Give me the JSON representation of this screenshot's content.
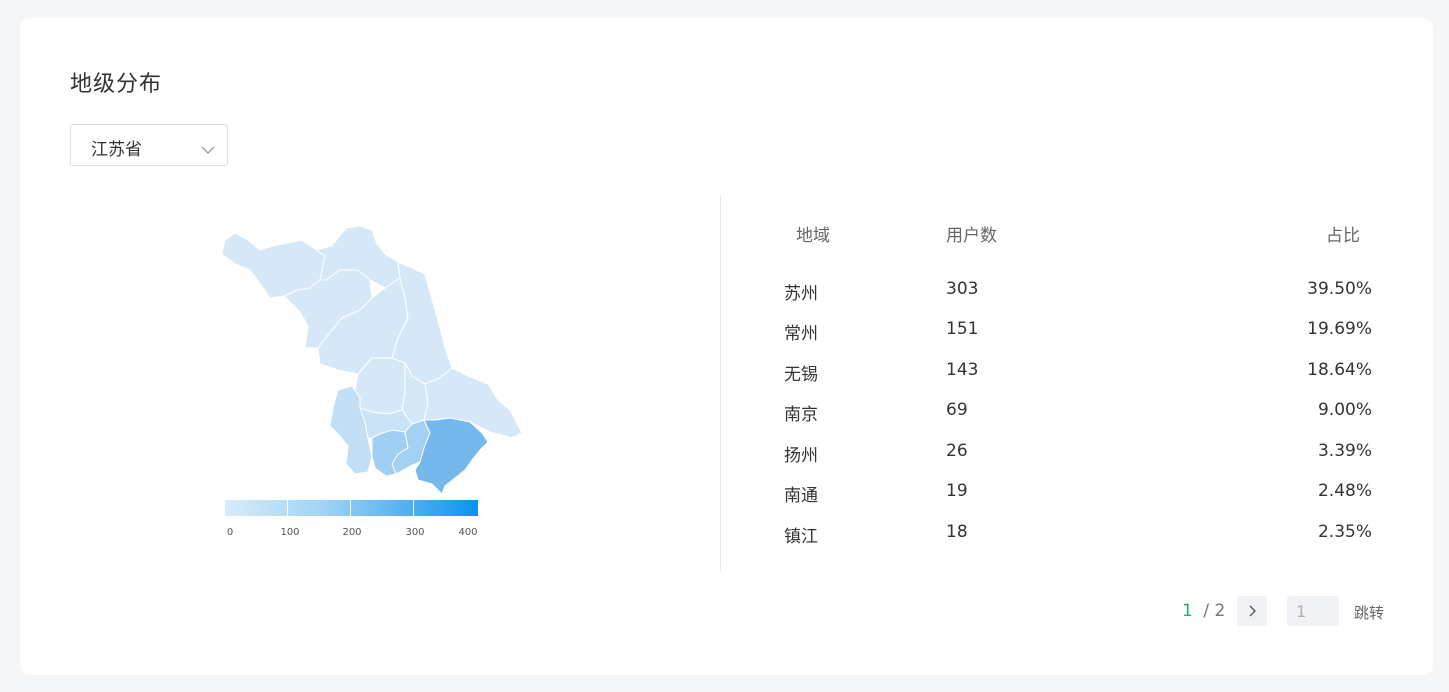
{
  "title": "地级分布",
  "province_select": {
    "value": "江苏省"
  },
  "legend": {
    "ticks": [
      "0",
      "100",
      "200",
      "300",
      "400"
    ],
    "min": 0,
    "max": 400
  },
  "table": {
    "headers": {
      "region": "地域",
      "users": "用户数",
      "ratio": "占比"
    },
    "rows": [
      {
        "region": "苏州",
        "users": "303",
        "ratio": "39.50%"
      },
      {
        "region": "常州",
        "users": "151",
        "ratio": "19.69%"
      },
      {
        "region": "无锡",
        "users": "143",
        "ratio": "18.64%"
      },
      {
        "region": "南京",
        "users": "69",
        "ratio": "9.00%"
      },
      {
        "region": "扬州",
        "users": "26",
        "ratio": "3.39%"
      },
      {
        "region": "南通",
        "users": "19",
        "ratio": "2.48%"
      },
      {
        "region": "镇江",
        "users": "18",
        "ratio": "2.35%"
      }
    ]
  },
  "pagination": {
    "current": "1",
    "rest": " / 2",
    "input_placeholder": "1",
    "jump_label": "跳转"
  },
  "colors": {
    "accent_green": "#27ae60",
    "map_base": "#d6e8f7",
    "map_high": "#0a94ef"
  }
}
